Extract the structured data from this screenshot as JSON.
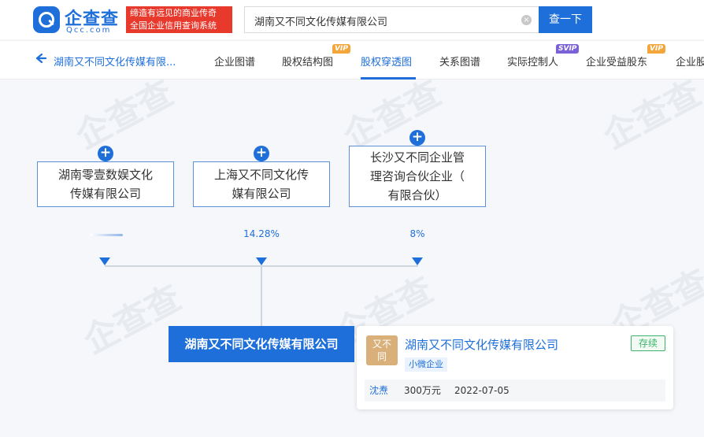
{
  "header": {
    "logo_text": "企查查",
    "logo_sub": "Qcc.com",
    "slogan_line1": "缔造有远见的商业传奇",
    "slogan_line2": "全国企业信用查询系统",
    "search_value": "湖南又不同文化传媒有限公司",
    "search_button": "查一下"
  },
  "nav": {
    "back_label": "湖南又不同文化传媒有限...",
    "tabs": [
      {
        "label": "企业图谱"
      },
      {
        "label": "股权结构图",
        "badge": "VIP"
      },
      {
        "label": "股权穿透图",
        "active": true
      },
      {
        "label": "关系图谱"
      },
      {
        "label": "实际控制人",
        "badge": "SVIP"
      },
      {
        "label": "企业受益股东",
        "badge": "VIP"
      },
      {
        "label": "企业股"
      }
    ]
  },
  "chart": {
    "shareholders": [
      {
        "name_line1": "湖南零壹数娱文化",
        "name_line2": "传媒有限公司",
        "name_line3": "",
        "percent": ""
      },
      {
        "name_line1": "上海又不同文化传",
        "name_line2": "媒有限公司",
        "name_line3": "",
        "percent": "14.28%"
      },
      {
        "name_line1": "长沙又不同企业管",
        "name_line2": "理咨询合伙企业（",
        "name_line3": "有限合伙）",
        "percent": "8%"
      }
    ],
    "target": "湖南又不同文化传媒有限公司"
  },
  "card": {
    "logo_line1": "又不",
    "logo_line2": "同",
    "name": "湖南又不同文化传媒有限公司",
    "status": "存续",
    "tag": "小微企业",
    "legal_person": "沈焘",
    "capital": "300万元",
    "date": "2022-07-05"
  },
  "colors": {
    "primary": "#1e6fd9",
    "slogan_bg": "#e8392d",
    "status_green": "#3fb36b"
  }
}
